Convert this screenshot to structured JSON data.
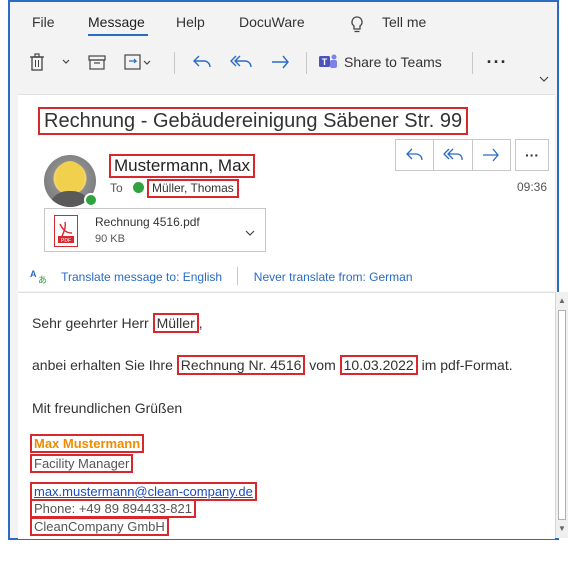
{
  "menu": {
    "tabs": [
      {
        "label": "File"
      },
      {
        "label": "Message"
      },
      {
        "label": "Help"
      },
      {
        "label": "DocuWare"
      },
      {
        "label": "Tell me"
      }
    ],
    "active": "Message"
  },
  "toolbar": {
    "share_label": "Share to Teams",
    "more_label": "···",
    "icons": [
      "delete-icon",
      "dropdown-icon",
      "archive-icon",
      "move-icon",
      "reply-icon",
      "reply-all-icon",
      "forward-icon",
      "teams-icon"
    ]
  },
  "email": {
    "subject": "Rechnung - Gebäudereinigung Säbener Str. 99",
    "sender": "Mustermann, Max",
    "to_label": "To",
    "recipient": "Müller, Thomas",
    "time": "09:36",
    "more_label": "···",
    "attachment": {
      "name": "Rechnung 4516.pdf",
      "size": "90 KB"
    },
    "translate": {
      "translate_link": "Translate message to: English",
      "never_link": "Never translate from: German"
    }
  },
  "body": {
    "greeting_prefix": "Sehr geehrter Herr ",
    "greeting_name": "Müller",
    "greeting_suffix": ",",
    "line2_prefix": "anbei erhalten Sie Ihre ",
    "invoice": "Rechnung Nr. 4516",
    "line2_mid": " vom ",
    "date": "10.03.2022",
    "line2_suffix": " im pdf-Format.",
    "closing": "Mit freundlichen Grüßen",
    "signature": {
      "name": "Max Mustermann",
      "role": "Facility Manager",
      "email": "max.mustermann@clean-company.de",
      "phone": "Phone: +49 89 894433-821",
      "company": "CleanCompany GmbH"
    }
  },
  "colors": {
    "accent": "#2b6bc5",
    "highlight_box": "#d9272e",
    "signature_name": "#f08c00",
    "presence": "#2fa33f"
  }
}
